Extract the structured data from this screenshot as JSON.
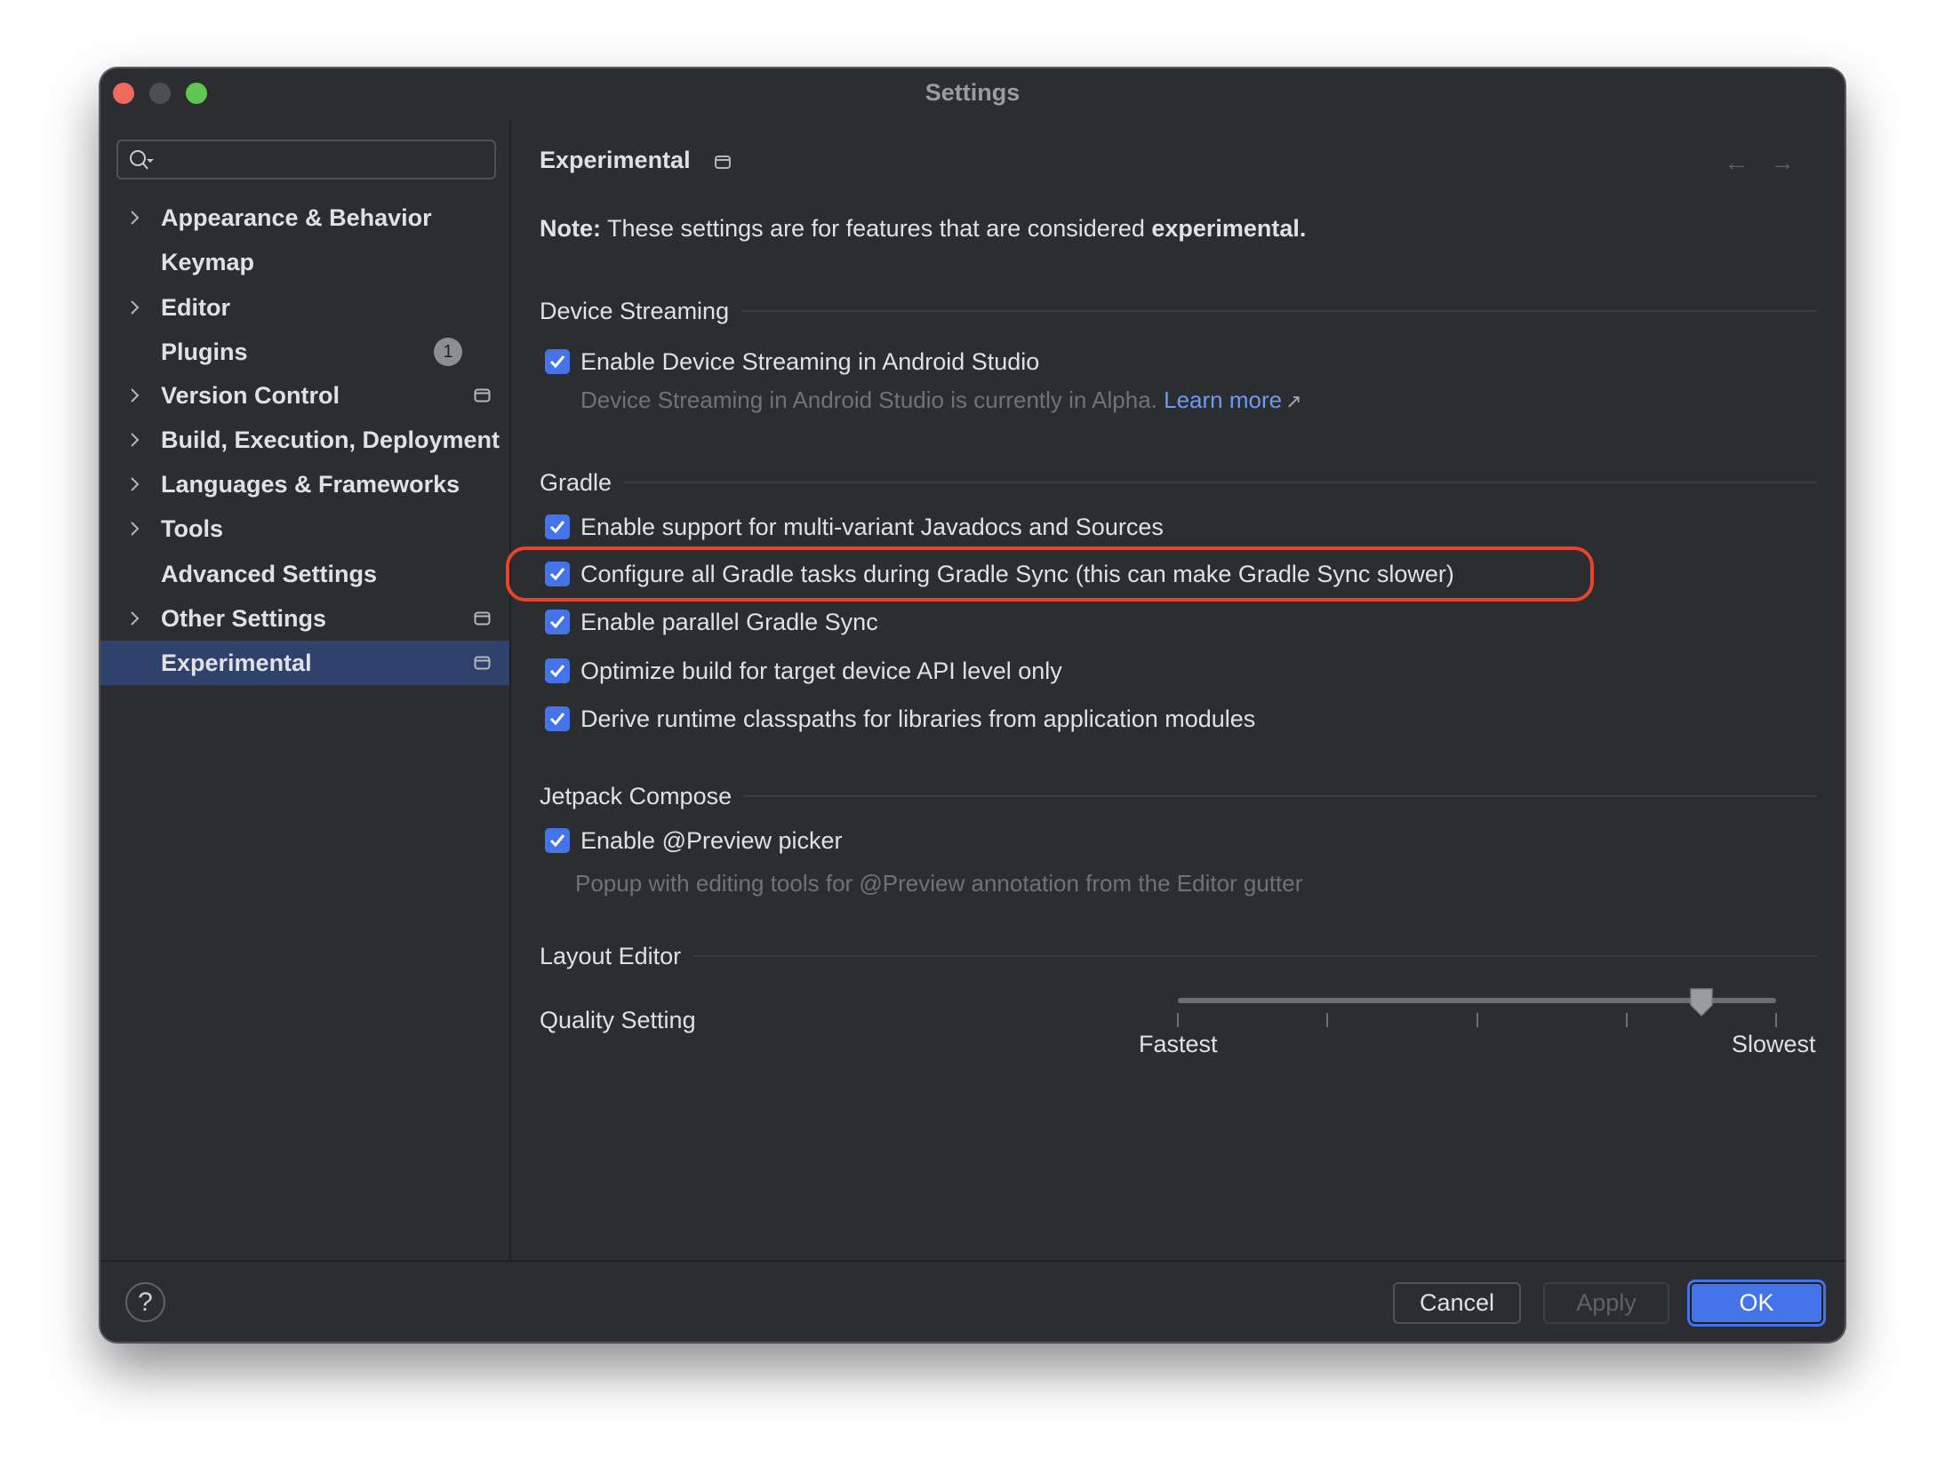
{
  "window": {
    "title": "Settings",
    "traffic_lights": [
      {
        "name": "close",
        "color": "#ed6a5e"
      },
      {
        "name": "minimize",
        "color": "#4d4e51"
      },
      {
        "name": "maximize",
        "color": "#61c554"
      }
    ]
  },
  "sidebar": {
    "search": {
      "value": "",
      "placeholder": ""
    },
    "items": [
      {
        "label": "Appearance & Behavior",
        "expandable": true
      },
      {
        "label": "Keymap",
        "expandable": false
      },
      {
        "label": "Editor",
        "expandable": true
      },
      {
        "label": "Plugins",
        "expandable": false,
        "badge": "1"
      },
      {
        "label": "Version Control",
        "expandable": true,
        "window_icon": true
      },
      {
        "label": "Build, Execution, Deployment",
        "expandable": true
      },
      {
        "label": "Languages & Frameworks",
        "expandable": true
      },
      {
        "label": "Tools",
        "expandable": true
      },
      {
        "label": "Advanced Settings",
        "expandable": false
      },
      {
        "label": "Other Settings",
        "expandable": true,
        "window_icon": true
      },
      {
        "label": "Experimental",
        "expandable": false,
        "window_icon": true,
        "selected": true
      }
    ]
  },
  "content": {
    "title": "Experimental",
    "back_icon": "arrow-left-icon",
    "forward_icon": "arrow-right-icon",
    "note": {
      "prefix": "Note:",
      "text": " These settings are for features that are considered ",
      "emphasis": "experimental."
    },
    "sections": {
      "device_streaming": {
        "title": "Device Streaming",
        "options": [
          {
            "label": "Enable Device Streaming in Android Studio",
            "checked": true
          }
        ],
        "description": "Device Streaming in Android Studio is currently in Alpha.",
        "link_label": "Learn more",
        "link_icon": "↗"
      },
      "gradle": {
        "title": "Gradle",
        "options": [
          {
            "label": "Enable support for multi-variant Javadocs and Sources",
            "checked": true
          },
          {
            "label": "Configure all Gradle tasks during Gradle Sync (this can make Gradle Sync slower)",
            "checked": true,
            "highlighted": true
          },
          {
            "label": "Enable parallel Gradle Sync",
            "checked": true
          },
          {
            "label": "Optimize build for target device API level only",
            "checked": true
          },
          {
            "label": "Derive runtime classpaths for libraries from application modules",
            "checked": true
          }
        ]
      },
      "jetpack_compose": {
        "title": "Jetpack Compose",
        "options": [
          {
            "label": "Enable @Preview picker",
            "checked": true
          }
        ],
        "description": "Popup with editing tools for @Preview annotation from the Editor gutter"
      },
      "layout_editor": {
        "title": "Layout Editor",
        "quality_label": "Quality Setting",
        "slider": {
          "min_label": "Fastest",
          "max_label": "Slowest",
          "value_fraction": 0.875,
          "ticks": 5
        }
      }
    }
  },
  "footer": {
    "help_label": "?",
    "cancel_label": "Cancel",
    "apply_label": "Apply",
    "ok_label": "OK"
  },
  "colors": {
    "accent": "#4574e8",
    "highlight_outline": "#e8432d",
    "selection": "#2f426b",
    "link": "#6e9af0",
    "background": "#2b2d30"
  }
}
